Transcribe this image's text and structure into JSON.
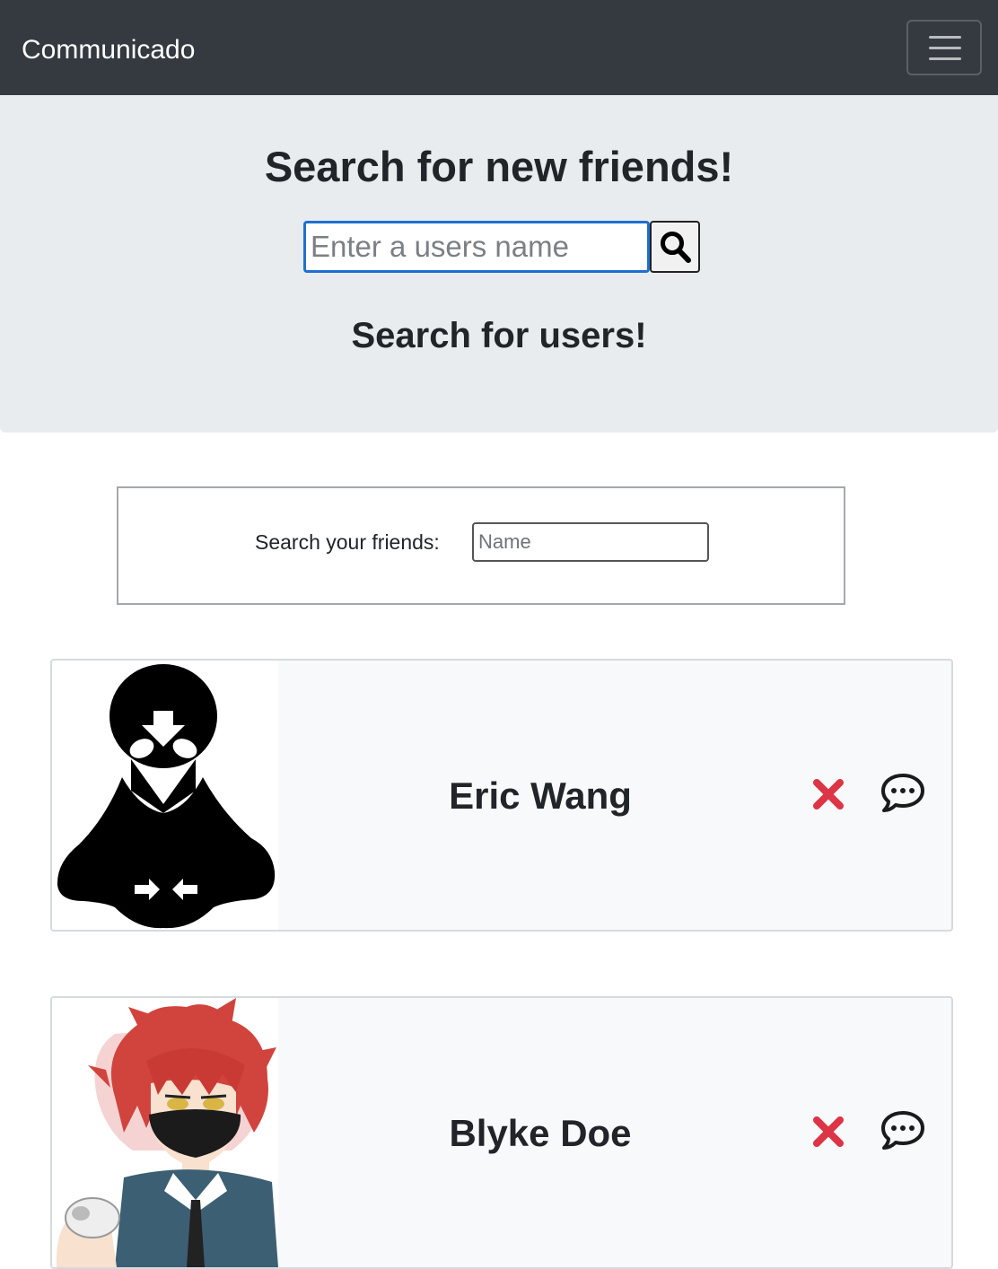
{
  "navbar": {
    "brand": "Communicado"
  },
  "hero": {
    "title": "Search for new friends!",
    "search_placeholder": "Enter a users name",
    "subtitle": "Search for users!"
  },
  "friends_filter": {
    "label": "Search your friends:",
    "placeholder": "Name"
  },
  "friends": [
    {
      "name": "Eric Wang"
    },
    {
      "name": "Blyke Doe"
    }
  ],
  "colors": {
    "navbar": "#343a40",
    "hero": "#e9ecef",
    "remove": "#dc3545",
    "input_focus": "#1f6fd1"
  }
}
